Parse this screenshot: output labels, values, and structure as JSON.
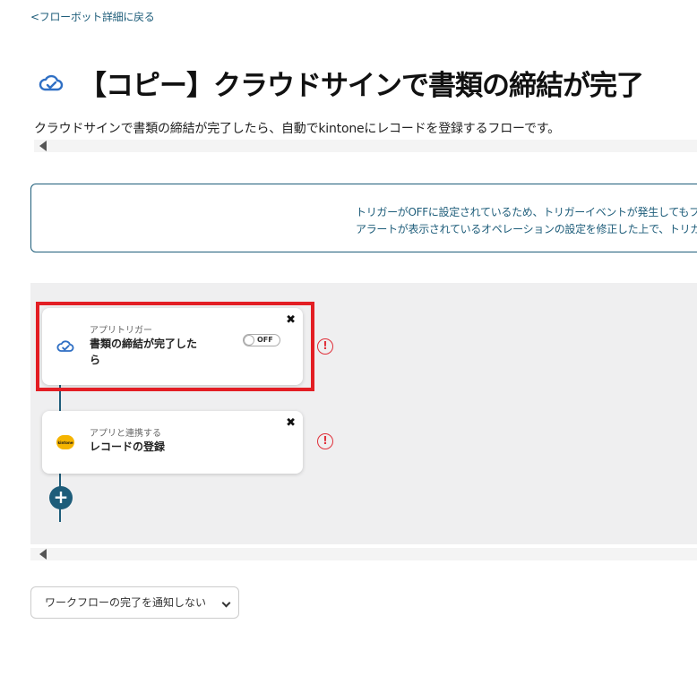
{
  "nav": {
    "back_label": "<フローボット詳細に戻る"
  },
  "header": {
    "title": "【コピー】クラウドサインで書類の締結が完了",
    "title_icon": "cloudsign-icon",
    "description": "クラウドサインで書類の締結が完了したら、自動でkintoneにレコードを登録するフローです。"
  },
  "alert": {
    "line1": "トリガーがOFFに設定されているため、トリガーイベントが発生してもフ",
    "line2": "アラートが表示されているオペレーションの設定を修正した上で、トリガ"
  },
  "flow": {
    "steps": [
      {
        "type_label": "アプリトリガー",
        "title": "書類の締結が完了したら",
        "icon": "cloudsign-icon",
        "toggle_label": "OFF",
        "warning": "!",
        "close": "✖"
      },
      {
        "type_label": "アプリと連携する",
        "title": "レコードの登録",
        "icon": "kintone-icon",
        "logo_text": "kintone",
        "warning": "!",
        "close": "✖"
      }
    ],
    "add_label": "+"
  },
  "footer": {
    "notify_select_value": "ワークフローの完了を通知しない"
  },
  "colors": {
    "accent": "#1e5d7a",
    "highlight": "#e31e24",
    "warning": "#e0303a",
    "kintone": "#f5b400"
  }
}
